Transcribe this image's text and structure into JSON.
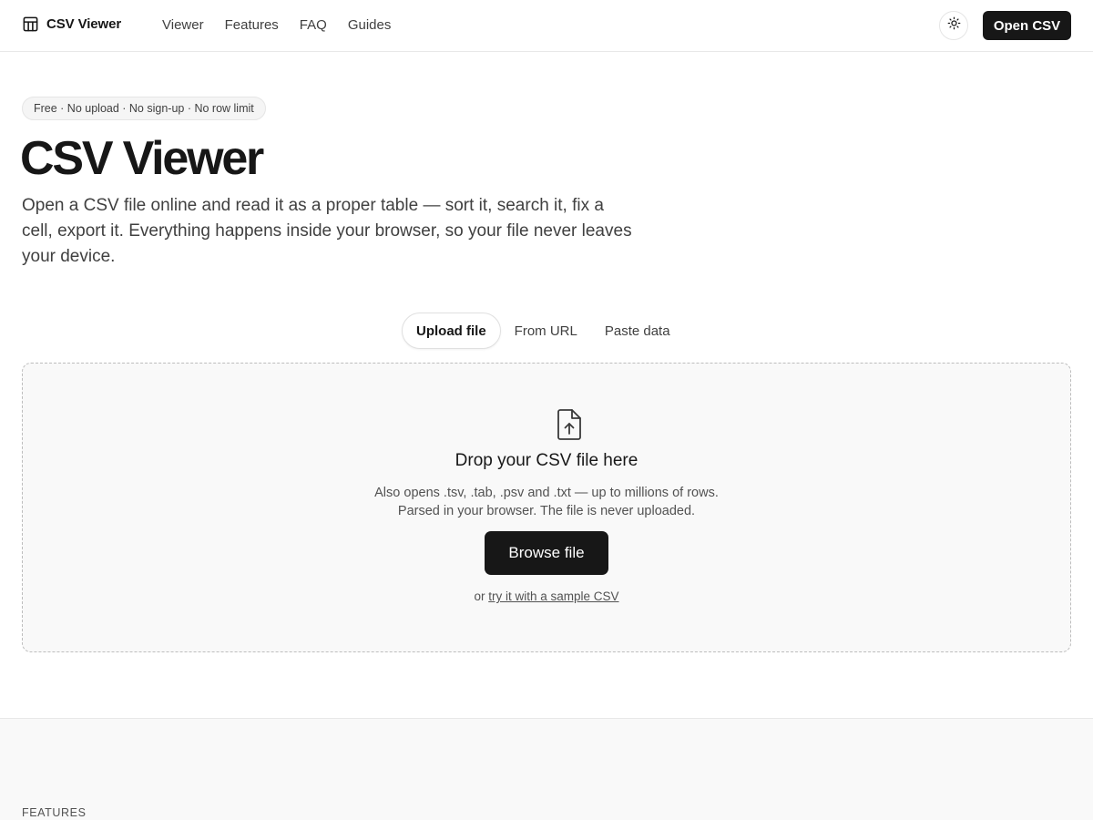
{
  "header": {
    "brand": "CSV Viewer",
    "nav": [
      "Viewer",
      "Features",
      "FAQ",
      "Guides"
    ],
    "theme_icon": "sun-icon",
    "open_button": "Open CSV"
  },
  "hero": {
    "badge": "Free · No upload · No sign-up · No row limit",
    "title": "CSV Viewer",
    "subtitle": "Open a CSV file online and read it as a proper table — sort it, search it, fix a cell, export it. Everything happens inside your browser, so your file never leaves your device."
  },
  "tabs": {
    "items": [
      "Upload file",
      "From URL",
      "Paste data"
    ],
    "active": "Upload file"
  },
  "dropzone": {
    "icon": "file-upload-icon",
    "title": "Drop your CSV file here",
    "desc_line1": "Also opens .tsv, .tab, .psv and .txt — up to millions of rows.",
    "desc_line2": "Parsed in your browser. The file is never uploaded.",
    "browse_button": "Browse file",
    "or_text": "or",
    "sample_link": "try it with a sample CSV"
  },
  "features": {
    "label": "FEATURES"
  }
}
